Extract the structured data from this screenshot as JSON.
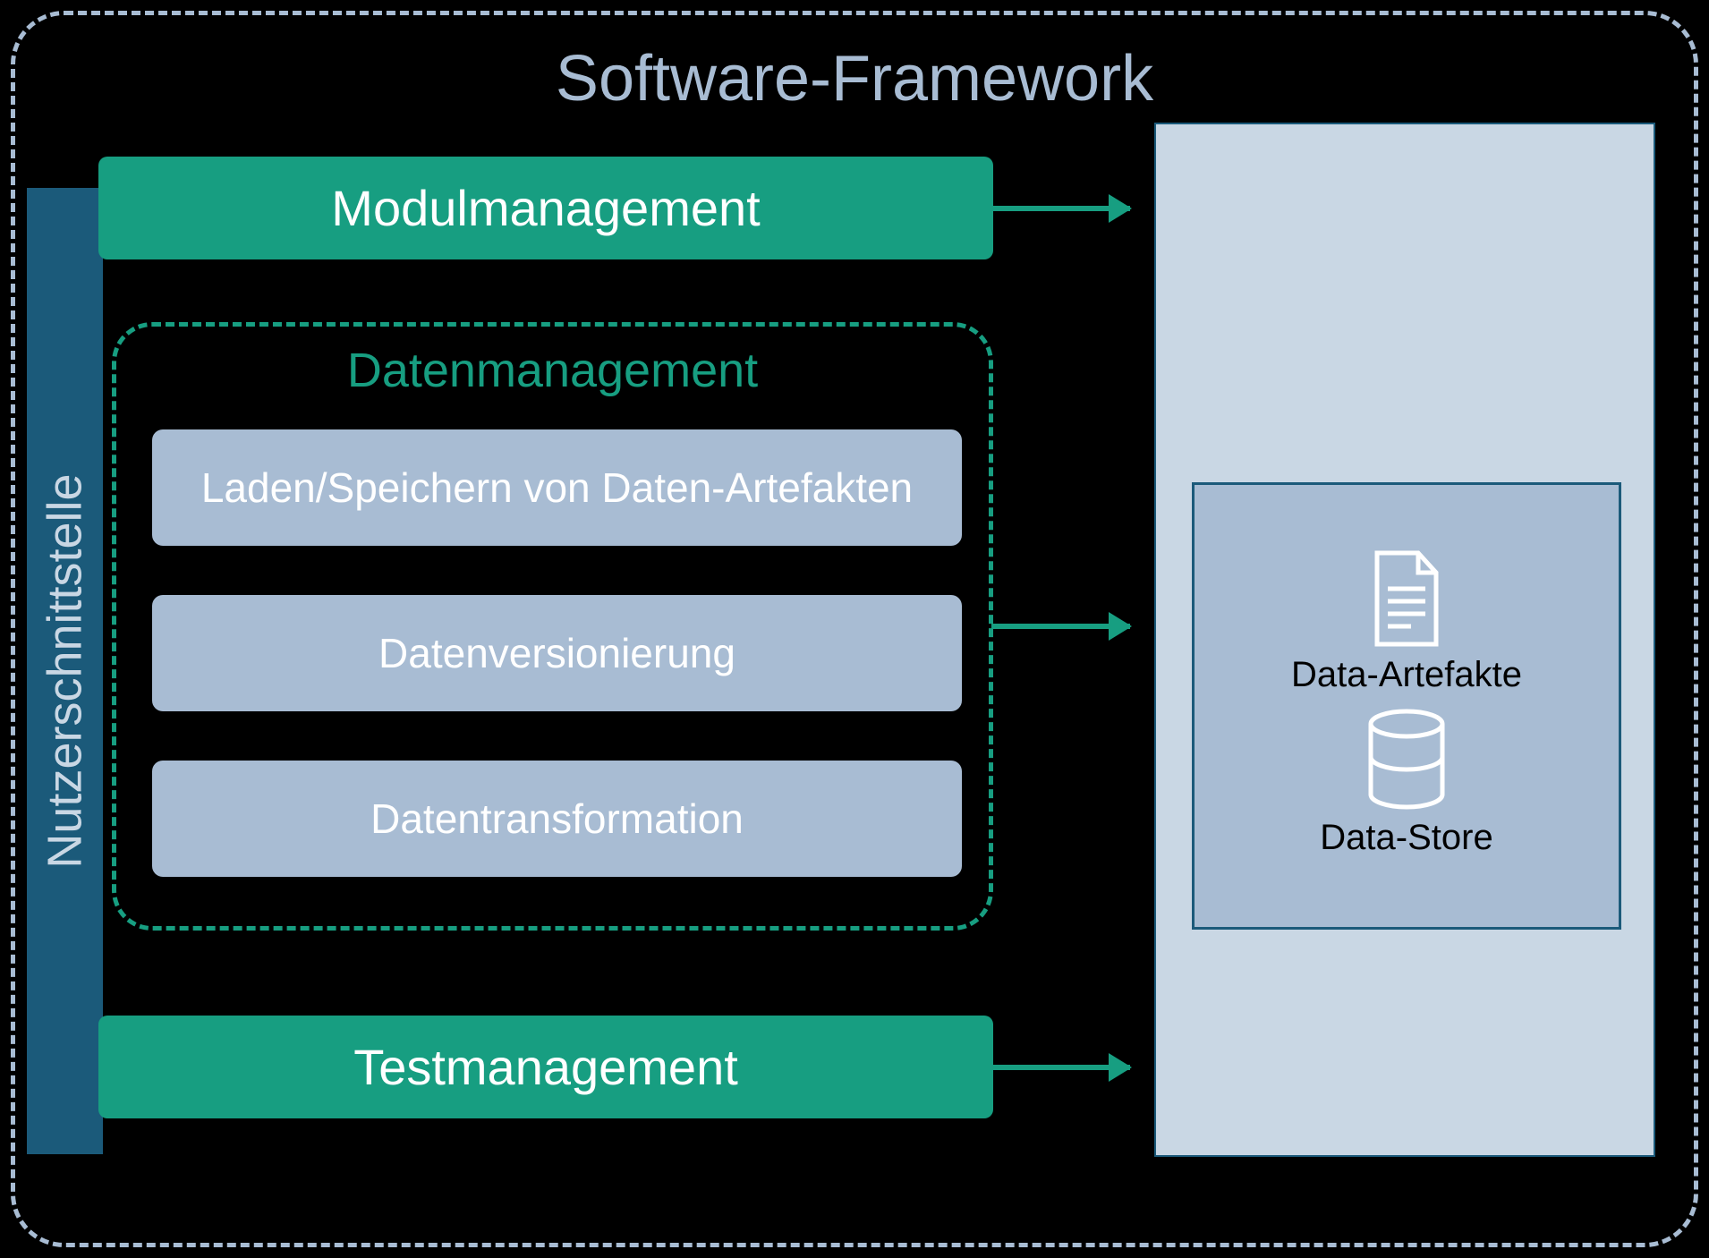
{
  "framework": {
    "title": "Software-Framework"
  },
  "nutzer": {
    "label": "Nutzerschnittstelle"
  },
  "modules": {
    "modulmanagement": "Modulmanagement",
    "testmanagement": "Testmanagement"
  },
  "datenmanagement": {
    "title": "Datenmanagement",
    "items": [
      "Laden/Speichern von Daten-Artefakten",
      "Datenversionierung",
      "Datentransformation"
    ]
  },
  "storage": {
    "artefakte_label": "Data-Artefakte",
    "store_label": "Data-Store"
  },
  "colors": {
    "teal": "#179e81",
    "lightblue": "#a8bcd3",
    "paleblue": "#c9d7e4",
    "darkteal": "#1b5a7a"
  }
}
